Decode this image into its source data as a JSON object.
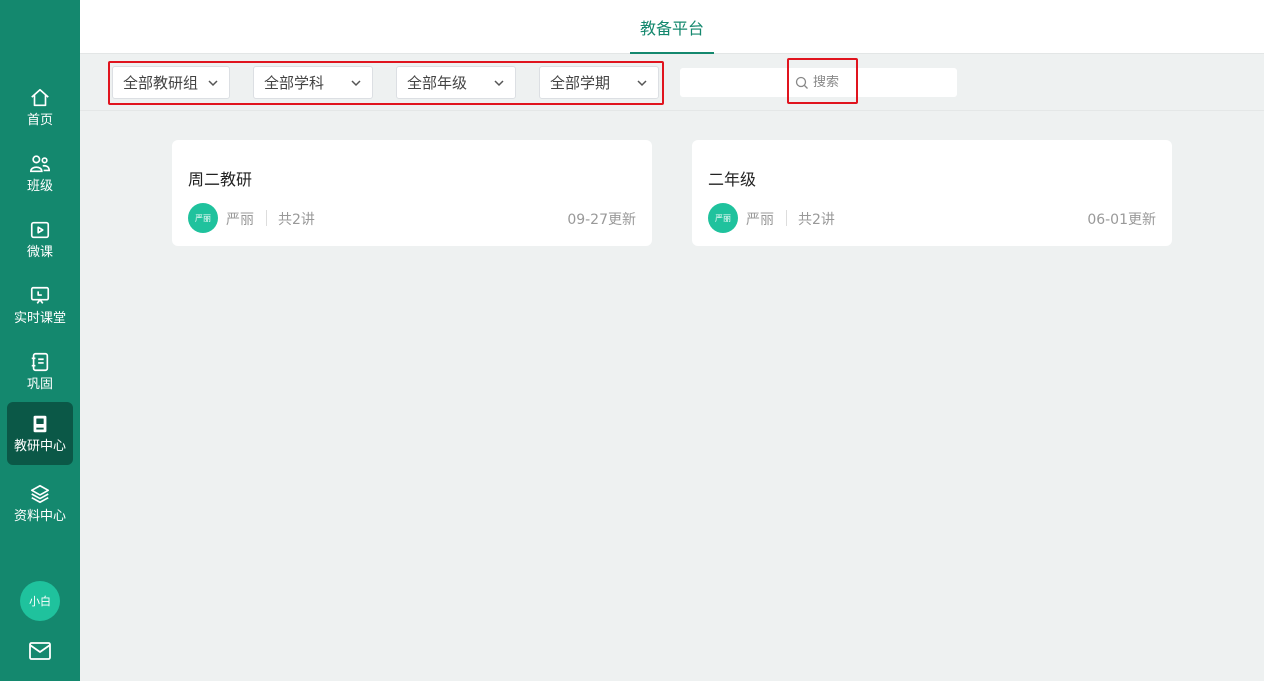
{
  "header": {
    "tab_label": "教备平台"
  },
  "sidebar": {
    "items": [
      {
        "label": "首页",
        "icon": "home-icon"
      },
      {
        "label": "班级",
        "icon": "users-icon"
      },
      {
        "label": "微课",
        "icon": "video-icon"
      },
      {
        "label": "实时课堂",
        "icon": "presentation-icon"
      },
      {
        "label": "巩固",
        "icon": "notebook-icon"
      },
      {
        "label": "教研中心",
        "icon": "book-icon",
        "active": true
      },
      {
        "label": "资料中心",
        "icon": "layers-icon"
      }
    ],
    "user_avatar": "小白",
    "mail_icon": "mail-icon"
  },
  "filters": {
    "group": "全部教研组",
    "subject": "全部学科",
    "grade": "全部年级",
    "term": "全部学期"
  },
  "search": {
    "placeholder": "搜索"
  },
  "cards": [
    {
      "title": "周二教研",
      "avatar": "严丽",
      "author": "严丽",
      "count": "共2讲",
      "date": "09-27更新"
    },
    {
      "title": "二年级",
      "avatar": "严丽",
      "author": "严丽",
      "count": "共2讲",
      "date": "06-01更新"
    }
  ],
  "colors": {
    "brand": "#14886e",
    "brand_dark": "#0b5847",
    "avatar": "#1fc29d",
    "highlight": "#e0141e"
  }
}
